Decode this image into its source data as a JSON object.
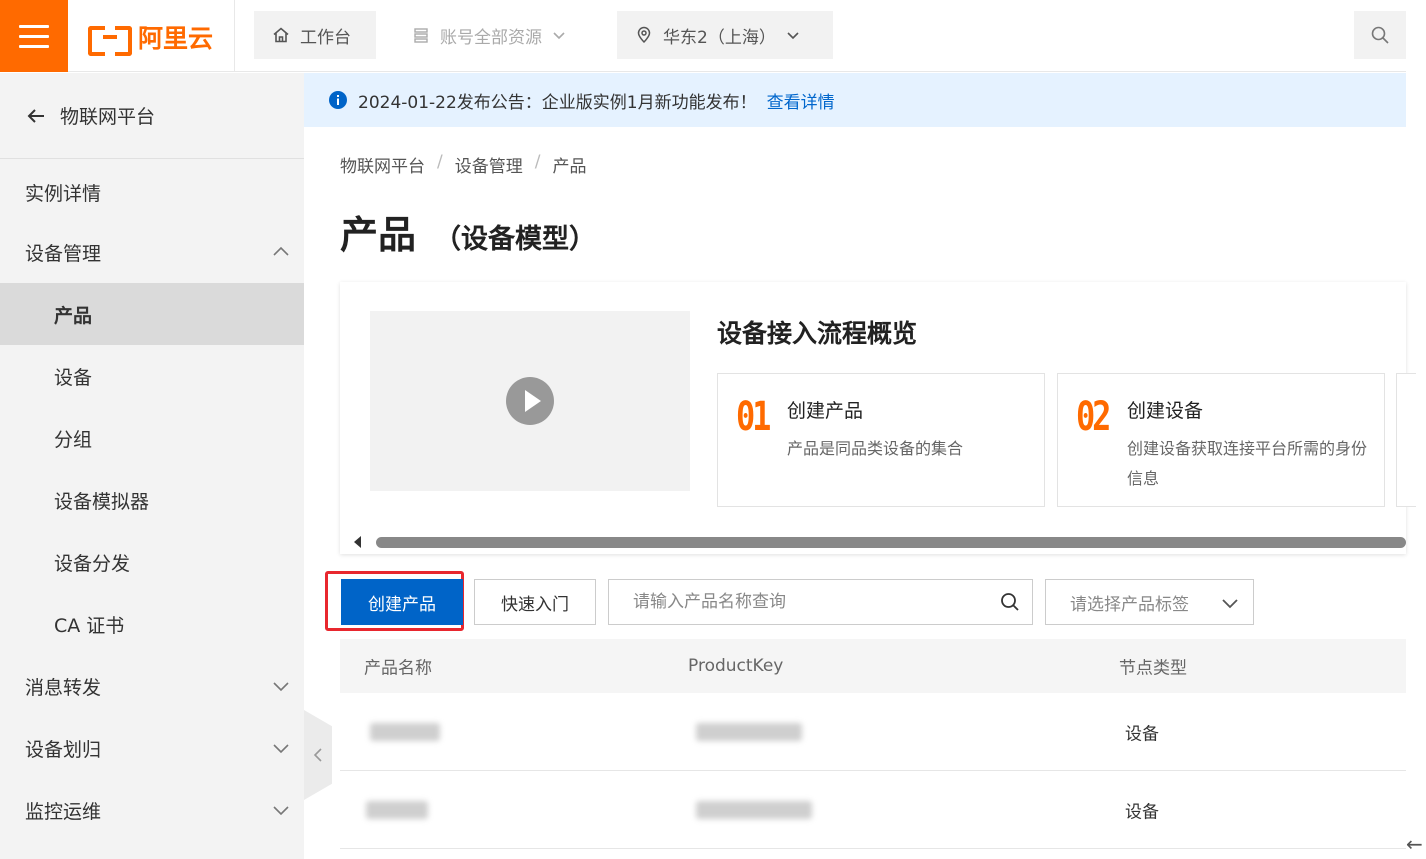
{
  "topbar": {
    "logo_text": "阿里云",
    "workbench_label": "工作台",
    "resources_label": "账号全部资源",
    "region_label": "华东2（上海）"
  },
  "sidebar": {
    "back_label": "物联网平台",
    "items": [
      {
        "label": "实例详情"
      },
      {
        "label": "设备管理"
      },
      {
        "label": "产品"
      },
      {
        "label": "设备"
      },
      {
        "label": "分组"
      },
      {
        "label": "设备模拟器"
      },
      {
        "label": "设备分发"
      },
      {
        "label": "CA 证书"
      },
      {
        "label": "消息转发"
      },
      {
        "label": "设备划归"
      },
      {
        "label": "监控运维"
      }
    ]
  },
  "notice": {
    "text": "2024-01-22发布公告：企业版实例1月新功能发布！",
    "link": "查看详情"
  },
  "breadcrumb": [
    "物联网平台",
    "设备管理",
    "产品"
  ],
  "page": {
    "title": "产品",
    "subtitle": "（设备模型）"
  },
  "flow": {
    "title": "设备接入流程概览",
    "steps": [
      {
        "num": "01",
        "name": "创建产品",
        "desc": "产品是同品类设备的集合"
      },
      {
        "num": "02",
        "name": "创建设备",
        "desc": "创建设备获取连接平台所需的身份信息"
      }
    ]
  },
  "toolbar": {
    "create_label": "创建产品",
    "quickstart_label": "快速入门",
    "search_placeholder": "请输入产品名称查询",
    "tag_placeholder": "请选择产品标签"
  },
  "table": {
    "headers": [
      "产品名称",
      "ProductKey",
      "节点类型"
    ],
    "rows": [
      {
        "node_type": "设备"
      },
      {
        "node_type": "设备"
      }
    ]
  },
  "colors": {
    "brand": "#ff6a00",
    "primary": "#0064c8",
    "highlight": "#e8272e",
    "link": "#0066cc"
  }
}
